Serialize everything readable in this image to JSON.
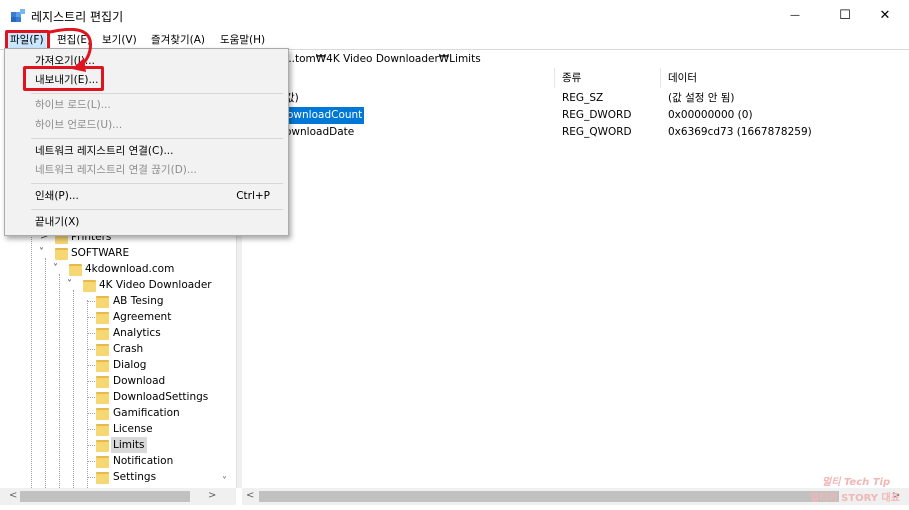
{
  "window": {
    "title": "레지스트리 편집기",
    "controls": {
      "minimize": "—",
      "maximize": "☐",
      "close": "✕"
    }
  },
  "menubar": {
    "file": "파일(F)",
    "edit": "편집(E)",
    "view": "보기(V)",
    "favorites": "즐겨찾기(A)",
    "help": "도움말(H)"
  },
  "address": {
    "path": "...tom₩4K Video Downloader₩Limits"
  },
  "file_menu": {
    "import": "가져오기(I)...",
    "export": "내보내기(E)...",
    "load_hive": "하이브 로드(L)...",
    "unload_hive": "하이브 언로드(U)...",
    "connect_network": "네트워크 레지스트리 연결(C)...",
    "disconnect_network": "네트워크 레지스트리 연결 끊기(D)...",
    "print": "인쇄(P)...",
    "print_shortcut": "Ctrl+P",
    "exit": "끝내기(X)"
  },
  "tree": {
    "items": [
      {
        "label": "Printers"
      },
      {
        "label": "SOFTWARE"
      },
      {
        "label": "4kdownload.com"
      },
      {
        "label": "4K Video Downloader"
      },
      {
        "label": "AB Tesing"
      },
      {
        "label": "Agreement"
      },
      {
        "label": "Analytics"
      },
      {
        "label": "Crash"
      },
      {
        "label": "Dialog"
      },
      {
        "label": "Download"
      },
      {
        "label": "DownloadSettings"
      },
      {
        "label": "Gamification"
      },
      {
        "label": "License"
      },
      {
        "label": "Limits"
      },
      {
        "label": "Notification"
      },
      {
        "label": "Settings"
      }
    ]
  },
  "list": {
    "columns": {
      "name": "",
      "type": "종류",
      "data": "데이터"
    },
    "rows": [
      {
        "name": "값)",
        "type": "REG_SZ",
        "data": "(값 설정 안 됨)"
      },
      {
        "name": "ownloadCount",
        "type": "REG_DWORD",
        "data": "0x00000000 (0)"
      },
      {
        "name": "ownloadDate",
        "type": "REG_QWORD",
        "data": "0x6369cd73 (1667878259)"
      }
    ]
  },
  "watermark": {
    "line1": "멀티 Tech Tip",
    "line2": "멀티의 STORY 대표"
  },
  "colors": {
    "accent": "#0078d7",
    "highlight": "#e0141e",
    "menu_hover": "#cce8ff"
  }
}
